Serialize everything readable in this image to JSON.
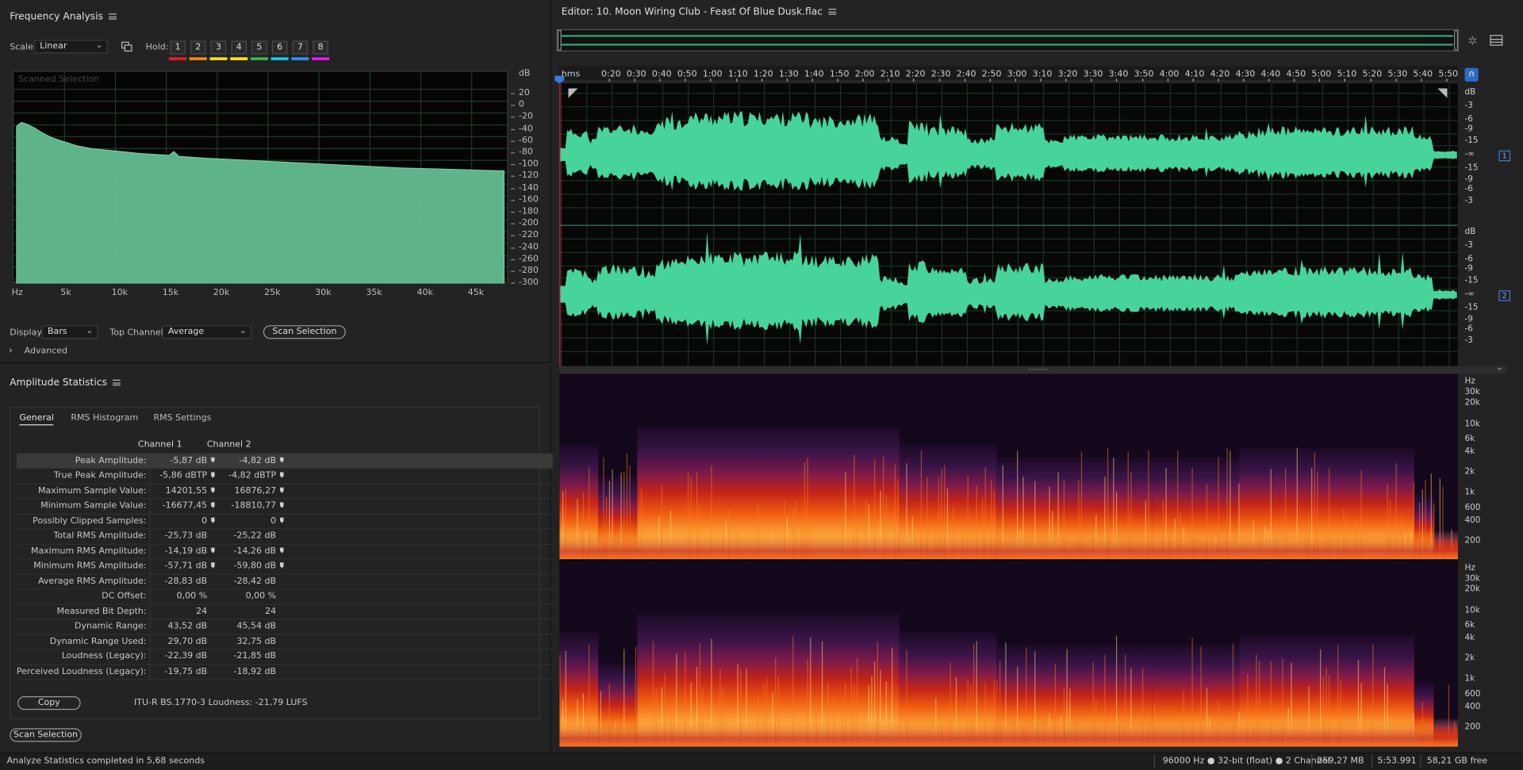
{
  "freq": {
    "title": "Frequency Analysis",
    "scale_label": "Scale:",
    "scale_value": "Linear",
    "hold_label": "Hold:",
    "holds": [
      "1",
      "2",
      "3",
      "4",
      "5",
      "6",
      "7",
      "8"
    ],
    "hold_colors": [
      "#e8192c",
      "#f08a1a",
      "#f2e21a",
      "#ffea00",
      "#39b54a",
      "#17c6e8",
      "#2f8ff0",
      "#e51ae8"
    ],
    "graph_caption": "Scanned Selection",
    "db_label": "dB",
    "db_ticks": [
      "20",
      "0",
      "-20",
      "-40",
      "-60",
      "-80",
      "-100",
      "-120",
      "-140",
      "-160",
      "-180",
      "-200",
      "-220",
      "-240",
      "-260",
      "-280",
      "-300"
    ],
    "hz_ticks": [
      "Hz",
      "5k",
      "10k",
      "15k",
      "20k",
      "25k",
      "30k",
      "35k",
      "40k",
      "45k"
    ],
    "display_label": "Display:",
    "display_value": "Bars",
    "top_channel_label": "Top Channel:",
    "top_channel_value": "Average",
    "scan_button": "Scan Selection",
    "advanced": "Advanced",
    "curve_color": "#63bd91"
  },
  "amp": {
    "title": "Amplitude Statistics",
    "tabs": [
      "General",
      "RMS Histogram",
      "RMS Settings"
    ],
    "col1": "Channel 1",
    "col2": "Channel 2",
    "rows": [
      {
        "label": "Peak Amplitude:",
        "c1": "-5,87 dB",
        "c2": "-4,82 dB",
        "f1": true,
        "f2": true
      },
      {
        "label": "True Peak Amplitude:",
        "c1": "-5,86 dBTP",
        "c2": "-4,82 dBTP",
        "f1": true,
        "f2": true
      },
      {
        "label": "Maximum Sample Value:",
        "c1": "14201,55",
        "c2": "16876,27",
        "f1": true,
        "f2": true
      },
      {
        "label": "Minimum Sample Value:",
        "c1": "-16677,45",
        "c2": "-18810,77",
        "f1": true,
        "f2": true
      },
      {
        "label": "Possibly Clipped Samples:",
        "c1": "0",
        "c2": "0",
        "f1": true,
        "f2": true
      },
      {
        "label": "Total RMS Amplitude:",
        "c1": "-25,73 dB",
        "c2": "-25,22 dB",
        "f1": false,
        "f2": false
      },
      {
        "label": "Maximum RMS Amplitude:",
        "c1": "-14,19 dB",
        "c2": "-14,26 dB",
        "f1": true,
        "f2": true
      },
      {
        "label": "Minimum RMS Amplitude:",
        "c1": "-57,71 dB",
        "c2": "-59,80 dB",
        "f1": true,
        "f2": true
      },
      {
        "label": "Average RMS Amplitude:",
        "c1": "-28,83 dB",
        "c2": "-28,42 dB",
        "f1": false,
        "f2": false
      },
      {
        "label": "DC Offset:",
        "c1": "0,00 %",
        "c2": "0,00 %",
        "f1": false,
        "f2": false
      },
      {
        "label": "Measured Bit Depth:",
        "c1": "24",
        "c2": "24",
        "f1": false,
        "f2": false
      },
      {
        "label": "Dynamic Range:",
        "c1": "43,52 dB",
        "c2": "45,54 dB",
        "f1": false,
        "f2": false
      },
      {
        "label": "Dynamic Range Used:",
        "c1": "29,70 dB",
        "c2": "32,75 dB",
        "f1": false,
        "f2": false
      },
      {
        "label": "Loudness (Legacy):",
        "c1": "-22,39 dB",
        "c2": "-21,85 dB",
        "f1": false,
        "f2": false
      },
      {
        "label": "Perceived Loudness (Legacy):",
        "c1": "-19,75 dB",
        "c2": "-18,92 dB",
        "f1": false,
        "f2": false
      }
    ],
    "copy_button": "Copy",
    "loudness_text": "ITU-R BS.1770-3 Loudness: -21,79 LUFS",
    "scan_button": "Scan Selection"
  },
  "editor": {
    "title": "Editor: 10. Moon Wiring Club - Feast Of Blue Dusk.flac",
    "time_unit": "hms",
    "time_ticks": [
      "0:20",
      "0:30",
      "0:40",
      "0:50",
      "1:00",
      "1:10",
      "1:20",
      "1:30",
      "1:40",
      "1:50",
      "2:00",
      "2:10",
      "2:20",
      "2:30",
      "2:40",
      "2:50",
      "3:00",
      "3:10",
      "3:20",
      "3:30",
      "3:40",
      "3:50",
      "4:00",
      "4:10",
      "4:20",
      "4:30",
      "4:40",
      "4:50",
      "5:00",
      "5:10",
      "5:20",
      "5:30",
      "5:40",
      "5:50"
    ],
    "db_ticks": [
      "dB",
      "-3",
      "-6",
      "-9",
      "-15",
      "-∞",
      "-15",
      "-9",
      "-6",
      "-3"
    ],
    "hz_ticks": [
      "Hz",
      "30k",
      "20k",
      "10k",
      "6k",
      "4k",
      "2k",
      "1k",
      "600",
      "400",
      "200"
    ],
    "channel1": "1",
    "channel2": "2",
    "wave_color": "#47d49a"
  },
  "status": {
    "left": "Analyze Statistics completed in 5,68 seconds",
    "format": "96000 Hz ● 32-bit (float) ● 2 Channel",
    "size": "259,27 MB",
    "duration": "5:53.991",
    "free": "58,21 GB free"
  }
}
